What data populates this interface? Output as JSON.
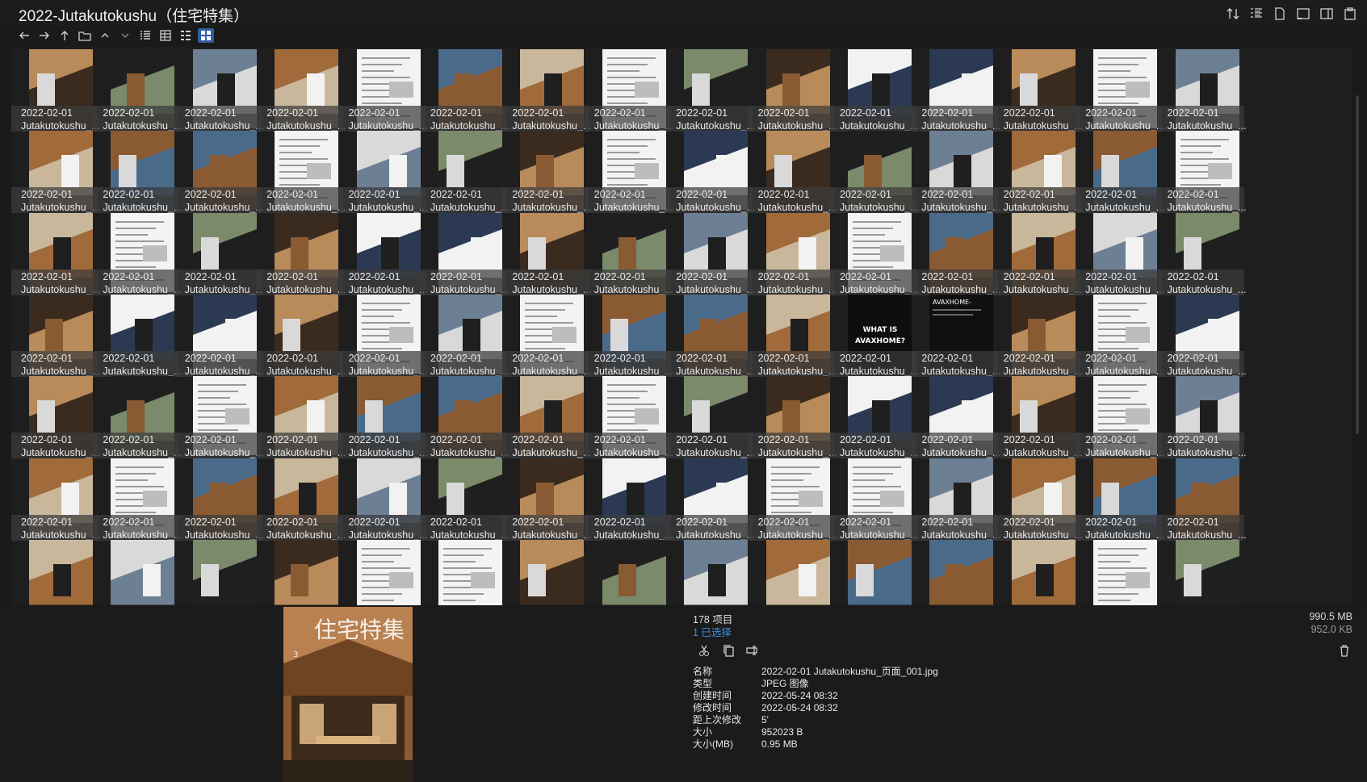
{
  "window": {
    "title": "2022-Jutakutokushu（住宅特集）"
  },
  "toolbar": {
    "nav_icons": [
      "back-icon",
      "forward-icon",
      "up-icon",
      "folder-icon",
      "chevron-up-icon",
      "chevron-down-icon"
    ],
    "view_icons": [
      "list-view-icon",
      "details-view-icon",
      "tiles-view-icon",
      "thumbnail-view-icon"
    ],
    "active_view": "thumbnail-view-icon",
    "right_icons": [
      "sort-icon",
      "layout-icon",
      "file-icon",
      "pane-icon",
      "preview-icon",
      "clipboard-icon"
    ]
  },
  "grid": {
    "item_date": "2022-02-01",
    "item_name": "Jutakutokushu_...",
    "columns": 15,
    "rows": 7,
    "thumb_palette": [
      "#b98a5a",
      "#d9d9d9",
      "#6d7f93",
      "#3b2b1f",
      "#8a5a32",
      "#2b3a52",
      "#c9b79c",
      "#1f1f1f",
      "#7a8a6a",
      "#a06a3a",
      "#f2f2f2",
      "#4a6a8a"
    ],
    "special_text_a": "WHAT IS AVAXHOME?",
    "special_text_b": "AVAXHOME-"
  },
  "status": {
    "count": "178 项目",
    "selected": "1 已选择",
    "total_size": "990.5 MB",
    "selected_size": "952.0 KB"
  },
  "actions": [
    "cut-icon",
    "copy-icon",
    "rename-icon",
    "delete-icon"
  ],
  "properties": [
    {
      "key": "名称",
      "value": "2022-02-01 Jutakutokushu_页面_001.jpg"
    },
    {
      "key": "类型",
      "value": "JPEG 图像"
    },
    {
      "key": "创建时间",
      "value": "2022-05-24  08:32"
    },
    {
      "key": "修改时间",
      "value": "2022-05-24  08:32"
    },
    {
      "key": "距上次修改",
      "value": "5'"
    },
    {
      "key": "大小",
      "value": "952023 B"
    },
    {
      "key": "大小(MB)",
      "value": "0.95 MB"
    }
  ],
  "preview": {
    "cover_title": "住宅特集",
    "cover_number": "3"
  }
}
